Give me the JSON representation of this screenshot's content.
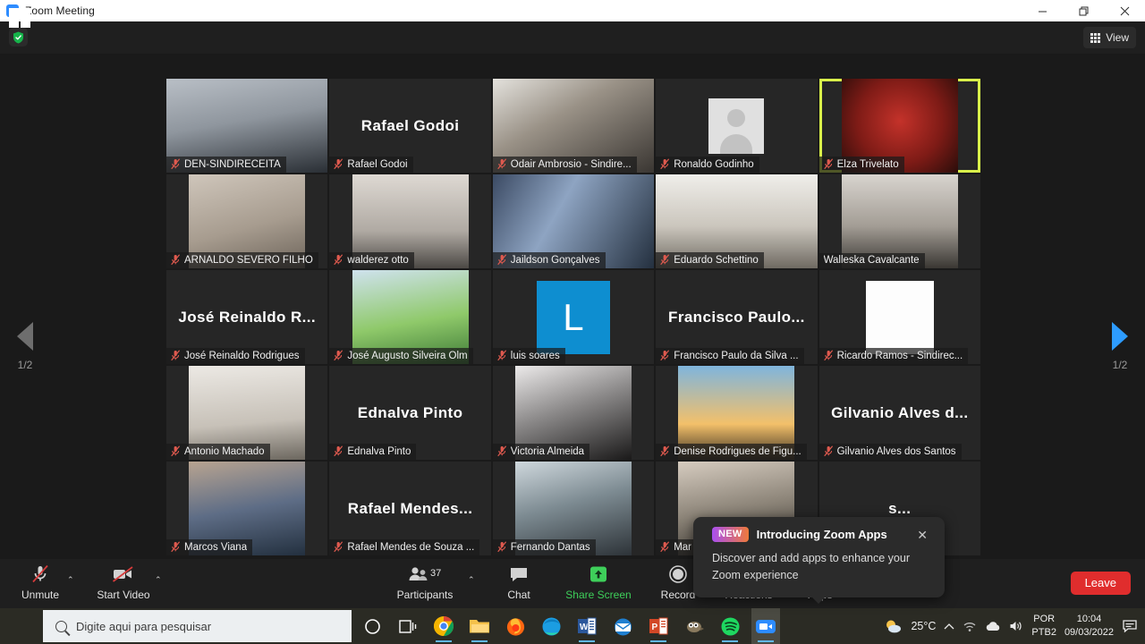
{
  "window": {
    "title": "Zoom Meeting",
    "app_icon": "zoom-video-icon",
    "minimize": "—",
    "maximize": "❐",
    "close": "✕"
  },
  "topbar": {
    "shield_icon": "security-shield-icon",
    "view_label": "View",
    "view_icon": "grid-view-icon"
  },
  "gallery": {
    "prev_icon": "chevron-left-icon",
    "next_icon": "chevron-right-icon",
    "page_indicator": "1/2",
    "mic_muted_icon": "microphone-muted-icon",
    "active_speaker_border": "#d9f24a",
    "participants": [
      {
        "name": "DEN-SINDIRECEITA",
        "display": "photo",
        "muted": true,
        "active": false
      },
      {
        "name": "Rafael Godoi",
        "display": "name",
        "big_name": "Rafael Godoi",
        "muted": true,
        "active": false
      },
      {
        "name": "Odair Ambrosio - Sindire...",
        "display": "photo",
        "muted": true,
        "active": false
      },
      {
        "name": "Ronaldo Godinho",
        "display": "avatar",
        "muted": true,
        "active": false
      },
      {
        "name": "Elza Trivelato",
        "display": "photo",
        "muted": true,
        "active": true
      },
      {
        "name": "ARNALDO SEVERO FILHO",
        "display": "photo",
        "muted": true,
        "active": false
      },
      {
        "name": "walderez otto",
        "display": "photo",
        "muted": true,
        "active": false
      },
      {
        "name": "Jaildson Gonçalves",
        "display": "photo",
        "muted": true,
        "active": false
      },
      {
        "name": "Eduardo Schettino",
        "display": "photo",
        "muted": true,
        "active": false
      },
      {
        "name": "Walleska Cavalcante",
        "display": "photo",
        "muted": false,
        "active": false
      },
      {
        "name": "José Reinaldo Rodrigues",
        "display": "name",
        "big_name": "José Reinaldo R...",
        "muted": true,
        "active": false
      },
      {
        "name": "José Augusto Silveira Olm",
        "display": "photo",
        "muted": true,
        "active": false
      },
      {
        "name": "luis soares",
        "display": "initial",
        "initial": "L",
        "muted": true,
        "active": false
      },
      {
        "name": "Francisco Paulo da Silva ...",
        "display": "name",
        "big_name": "Francisco Paulo...",
        "muted": true,
        "active": false
      },
      {
        "name": "Ricardo Ramos - Sindirec...",
        "display": "blank",
        "muted": true,
        "active": false
      },
      {
        "name": "Antonio Machado",
        "display": "photo",
        "muted": true,
        "active": false
      },
      {
        "name": "Ednalva Pinto",
        "display": "name",
        "big_name": "Ednalva Pinto",
        "muted": true,
        "active": false
      },
      {
        "name": "Victoria Almeida",
        "display": "photo",
        "muted": true,
        "active": false
      },
      {
        "name": "Denise Rodrigues de Figu...",
        "display": "photo",
        "muted": true,
        "active": false
      },
      {
        "name": "Gilvanio Alves dos Santos",
        "display": "name",
        "big_name": "Gilvanio Alves d...",
        "muted": true,
        "active": false
      },
      {
        "name": "Marcos Viana",
        "display": "photo",
        "muted": true,
        "active": false
      },
      {
        "name": "Rafael Mendes de Souza ...",
        "display": "name",
        "big_name": "Rafael  Mendes...",
        "muted": true,
        "active": false
      },
      {
        "name": "Fernando Dantas",
        "display": "photo",
        "muted": true,
        "active": false
      },
      {
        "name": "Mar",
        "display": "photo",
        "muted": true,
        "active": false
      },
      {
        "name": "",
        "display": "name",
        "big_name": "s...",
        "muted": false,
        "active": false
      }
    ]
  },
  "popup": {
    "badge": "NEW",
    "title": "Introducing Zoom Apps",
    "body": "Discover and add apps to enhance your Zoom experience",
    "close_icon": "close-icon"
  },
  "toolbar": {
    "mute": {
      "label": "Unmute",
      "icon": "microphone-muted-icon",
      "caret": "⌃"
    },
    "video": {
      "label": "Start Video",
      "icon": "video-off-icon",
      "caret": "⌃"
    },
    "participants": {
      "label": "Participants",
      "count": "37",
      "icon": "people-icon",
      "caret": "⌃"
    },
    "chat": {
      "label": "Chat",
      "icon": "chat-bubble-icon"
    },
    "share": {
      "label": "Share Screen",
      "icon": "share-screen-icon",
      "color": "#3ecf5a"
    },
    "record": {
      "label": "Record",
      "icon": "record-circle-icon"
    },
    "reactions": {
      "label": "Reactions",
      "icon": "reactions-smiley-icon"
    },
    "apps": {
      "label": "Apps",
      "icon": "apps-bracket-icon"
    },
    "leave": {
      "label": "Leave",
      "color": "#e02d2d"
    }
  },
  "taskbar": {
    "start_icon": "windows-start-icon",
    "search_placeholder": "Digite aqui para pesquisar",
    "search_icon": "search-icon",
    "items": [
      {
        "name": "cortana-icon"
      },
      {
        "name": "task-view-icon"
      },
      {
        "name": "chrome-icon"
      },
      {
        "name": "file-explorer-icon"
      },
      {
        "name": "firefox-icon"
      },
      {
        "name": "edge-icon"
      },
      {
        "name": "word-icon"
      },
      {
        "name": "thunderbird-icon"
      },
      {
        "name": "powerpoint-icon"
      },
      {
        "name": "gimp-icon"
      },
      {
        "name": "spotify-icon"
      },
      {
        "name": "zoom-icon"
      }
    ],
    "tray": {
      "weather_icon": "weather-partly-cloudy-icon",
      "temperature": "25°C",
      "chevron_icon": "chevron-up-icon",
      "network_icon": "wifi-icon",
      "onedrive_icon": "cloud-icon",
      "volume_icon": "speaker-icon",
      "lang_line1": "POR",
      "lang_line2": "PTB2",
      "time": "10:04",
      "date": "09/03/2022",
      "notifications_icon": "notification-icon"
    }
  }
}
